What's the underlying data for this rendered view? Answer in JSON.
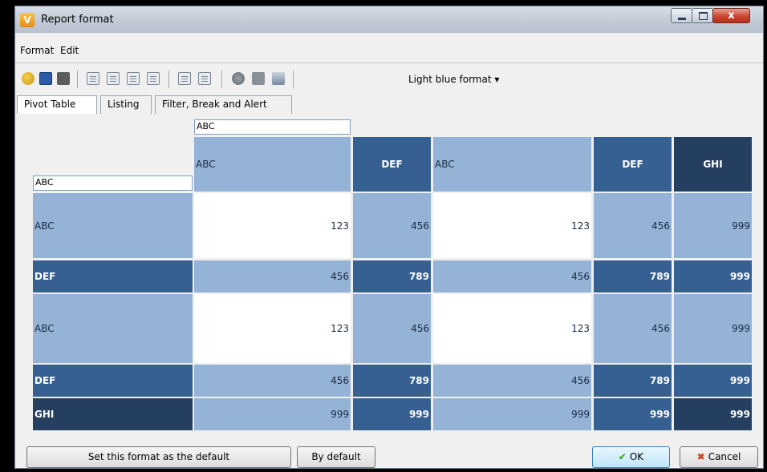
{
  "window": {
    "title": "Report format",
    "close_glyph": "x",
    "app_icon_letter": "V"
  },
  "menu": [
    "Format",
    "Edit"
  ],
  "toolbar": {
    "format_dropdown": "Light blue format",
    "icons": [
      "open-icon",
      "save-icon",
      "stop-icon",
      "format-1-icon",
      "format-2-icon",
      "format-3-icon",
      "format-4-icon",
      "format-5-icon",
      "format-6-icon",
      "tool-1-icon",
      "tool-2-icon",
      "tool-3-icon"
    ]
  },
  "tabs": [
    "Pivot Table",
    "Listing",
    "Filter, Break and Alert"
  ],
  "pivot": {
    "column_field": "ABC",
    "row_field": "ABC",
    "column_headers": [
      "ABC",
      "DEF",
      "ABC",
      "DEF",
      "GHI"
    ],
    "rows": [
      {
        "label": "ABC",
        "values": [
          "123",
          "456",
          "123",
          "456",
          "999"
        ]
      },
      {
        "label": "DEF",
        "values": [
          "456",
          "789",
          "456",
          "789",
          "999"
        ]
      },
      {
        "label": "ABC",
        "values": [
          "123",
          "456",
          "123",
          "456",
          "999"
        ]
      },
      {
        "label": "DEF",
        "values": [
          "456",
          "789",
          "456",
          "789",
          "999"
        ]
      },
      {
        "label": "GHI",
        "values": [
          "999",
          "999",
          "999",
          "999",
          "999"
        ]
      }
    ]
  },
  "footer": {
    "set_default": "Set this format as the default",
    "by_default": "By default",
    "ok": "OK",
    "cancel": "Cancel"
  },
  "colors": {
    "light": "#95b3d7",
    "mid": "#366092",
    "dark": "#243f60"
  }
}
